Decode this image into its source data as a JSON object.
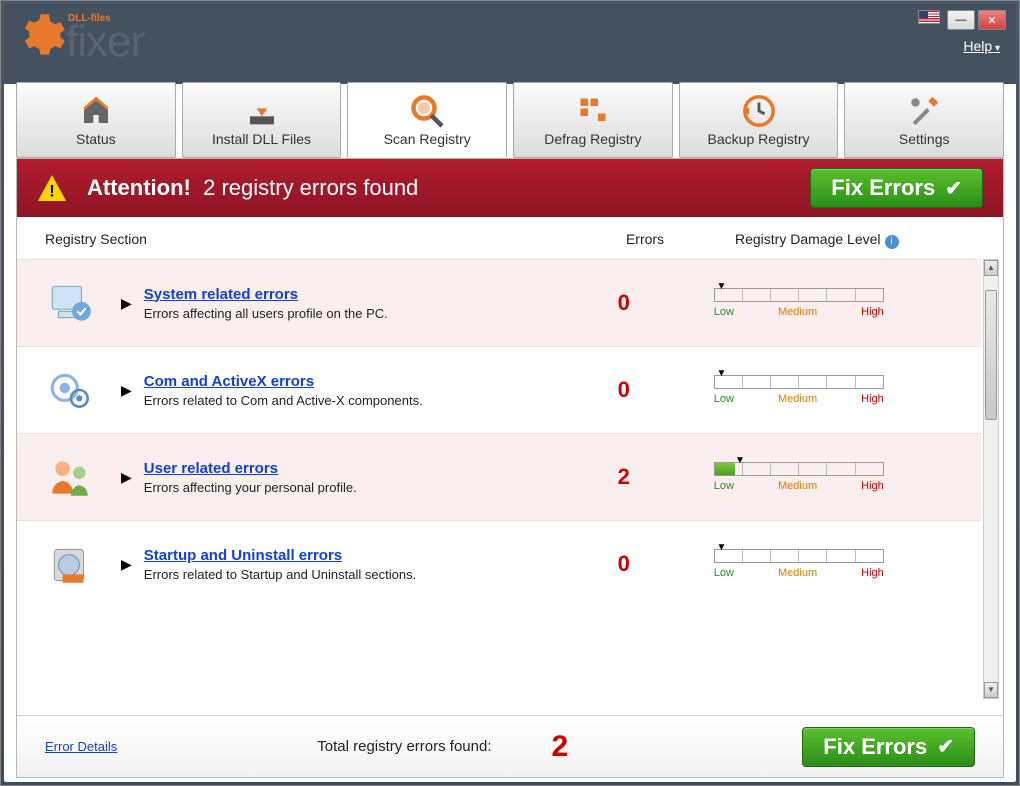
{
  "app": {
    "brand": "DLL-files",
    "name": "fixer"
  },
  "help_label": "Help",
  "tabs": [
    {
      "label": "Status"
    },
    {
      "label": "Install DLL Files"
    },
    {
      "label": "Scan Registry"
    },
    {
      "label": "Defrag Registry"
    },
    {
      "label": "Backup Registry"
    },
    {
      "label": "Settings"
    }
  ],
  "banner": {
    "attention": "Attention!",
    "message": "2 registry errors found",
    "fix_label": "Fix Errors"
  },
  "columns": {
    "section": "Registry Section",
    "errors": "Errors",
    "damage": "Registry Damage Level"
  },
  "rows": [
    {
      "title": "System related errors",
      "desc": "Errors affecting all users profile on the PC.",
      "count": "0",
      "fill_pct": 0
    },
    {
      "title": "Com and ActiveX errors",
      "desc": "Errors related to Com and Active-X components.",
      "count": "0",
      "fill_pct": 0
    },
    {
      "title": "User related errors",
      "desc": "Errors affecting your personal profile.",
      "count": "2",
      "fill_pct": 12
    },
    {
      "title": "Startup and Uninstall errors",
      "desc": "Errors related to Startup and Uninstall sections.",
      "count": "0",
      "fill_pct": 0
    }
  ],
  "damage_labels": {
    "low": "Low",
    "medium": "Medium",
    "high": "High"
  },
  "footer": {
    "details": "Error Details",
    "total_label": "Total registry errors found:",
    "total_count": "2",
    "fix_label": "Fix Errors"
  }
}
